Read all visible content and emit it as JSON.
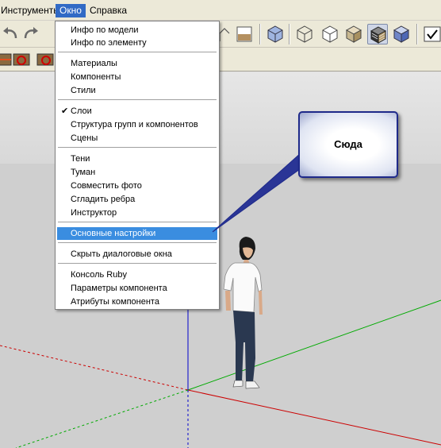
{
  "menubar": {
    "items": [
      {
        "label": "Инструменты"
      },
      {
        "label": "Окно"
      },
      {
        "label": "Справка"
      }
    ]
  },
  "window_menu": {
    "items": [
      {
        "label": "Инфо по модели"
      },
      {
        "label": "Инфо по элементу"
      },
      {
        "label": "Материалы"
      },
      {
        "label": "Компоненты"
      },
      {
        "label": "Стили"
      },
      {
        "label": "Слои",
        "checked": true
      },
      {
        "label": "Структура групп и компонентов"
      },
      {
        "label": "Сцены"
      },
      {
        "label": "Тени"
      },
      {
        "label": "Туман"
      },
      {
        "label": "Совместить фото"
      },
      {
        "label": "Сгладить ребра"
      },
      {
        "label": "Инструктор"
      },
      {
        "label": "Основные настройки",
        "highlighted": true
      },
      {
        "label": "Скрыть диалоговые окна"
      },
      {
        "label": "Консоль Ruby"
      },
      {
        "label": "Параметры компонента"
      },
      {
        "label": "Атрибуты компонента"
      }
    ]
  },
  "check_mark": "✔",
  "callout": {
    "text": "Сюда"
  },
  "colors": {
    "menu_highlight": "#3a8de0",
    "menubar_active": "#316ac5",
    "sky": "#e0e0e0",
    "ground": "#cfcfcf",
    "axis_red": "#cc0000",
    "axis_green": "#00aa00",
    "axis_blue": "#0000cc",
    "callout_border": "#1f2a8a"
  }
}
